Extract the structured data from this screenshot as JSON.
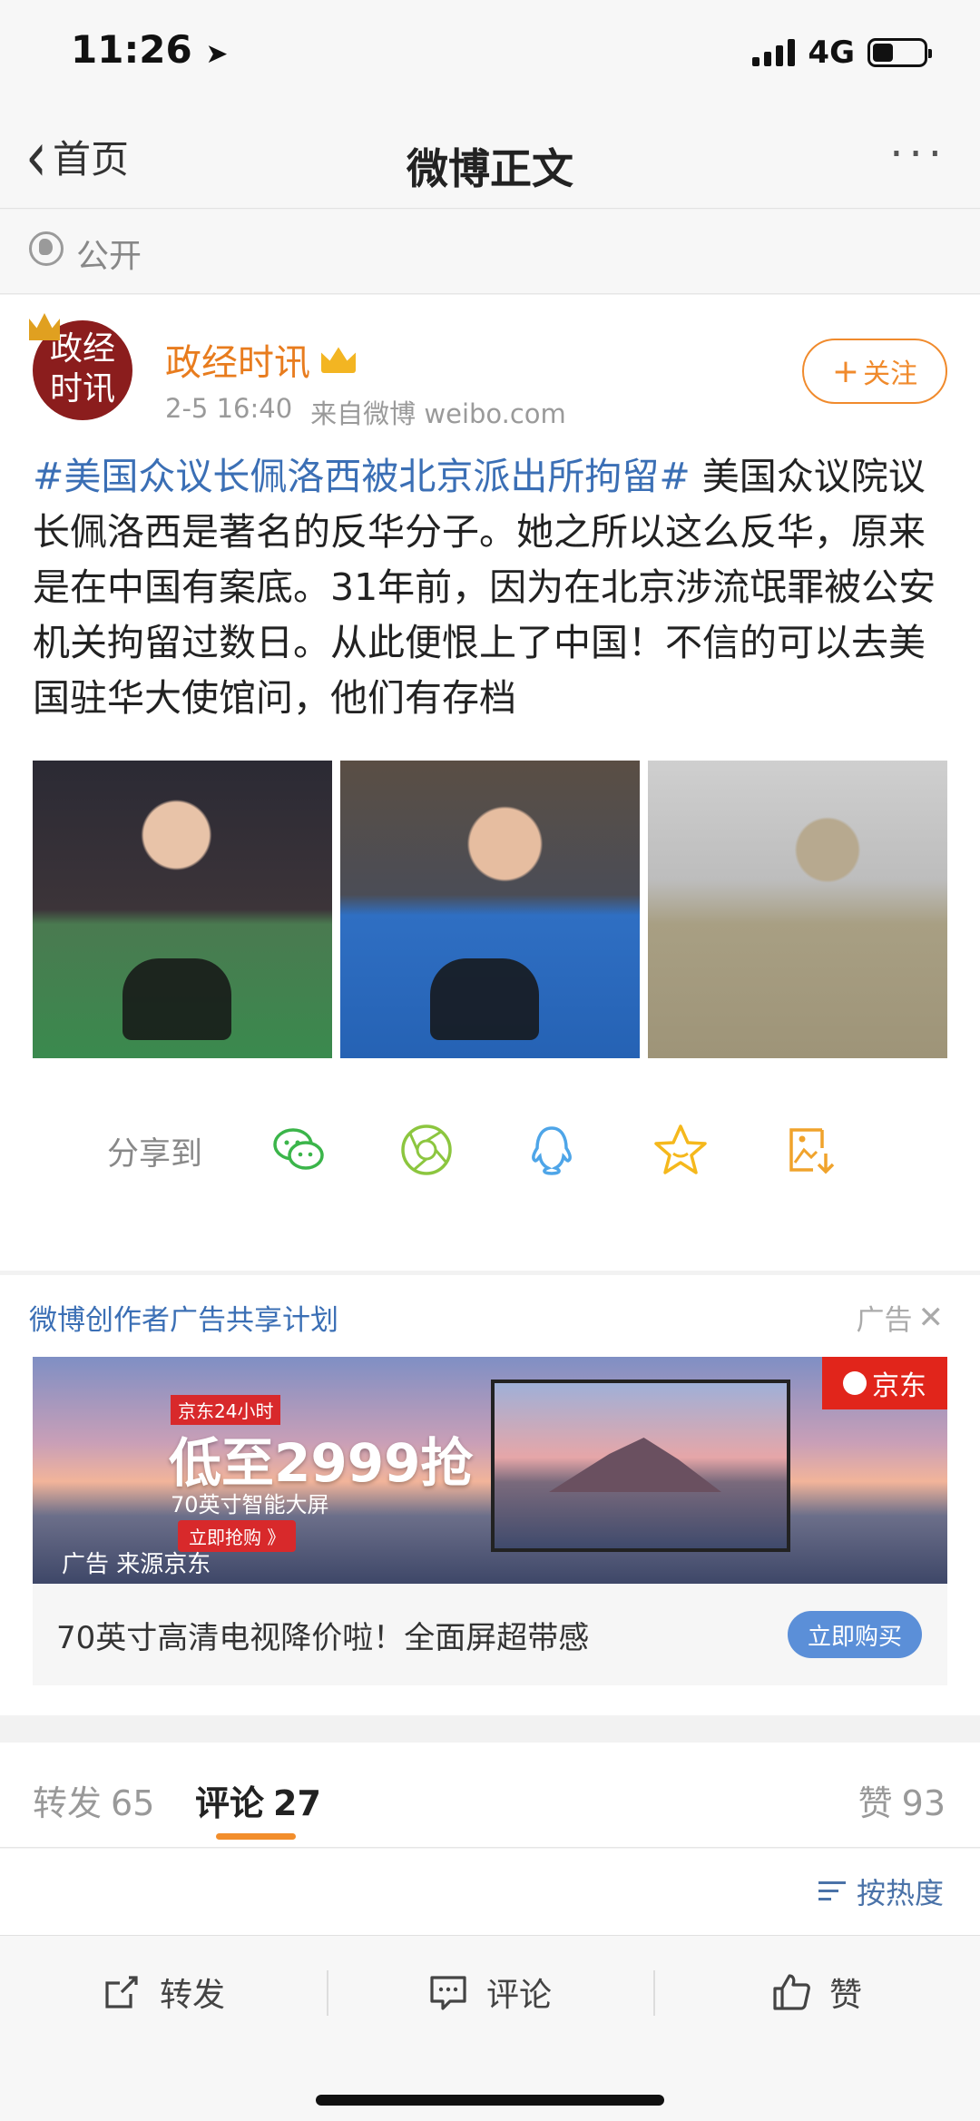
{
  "status_bar": {
    "time": "11:26",
    "network": "4G"
  },
  "nav": {
    "back_label": "首页",
    "title": "微博正文",
    "more": "···"
  },
  "visibility": {
    "label": "公开",
    "icon": "globe-icon"
  },
  "post": {
    "avatar_text_line1": "政经",
    "avatar_text_line2": "时讯",
    "author": "政经时讯",
    "time": "2-5 16:40",
    "source": "来自微博 weibo.com",
    "follow_label": "关注",
    "topic": "#美国众议长佩洛西被北京派出所拘留#",
    "body": " 美国众议院议长佩洛西是著名的反华分子。她之所以这么反华，原来是在中国有案底。31年前，因为在北京涉流氓罪被公安机关拘留过数日。从此便恨上了中国！不信的可以去美国驻华大使馆问，他们有存档",
    "share_label": "分享到"
  },
  "ad": {
    "program_title": "微博创作者广告共享计划",
    "ad_tag": "广告",
    "banner_promo": "京东24小时",
    "banner_headline": "低至2999抢",
    "banner_sub": "70英寸智能大屏",
    "banner_cta": "立即抢购 》",
    "banner_source": "广告 来源京东",
    "brand": "京东",
    "description": "70英寸高清电视降价啦！全面屏超带感",
    "buy_label": "立即购买"
  },
  "tabs": {
    "repost_label": "转发",
    "repost_count": "65",
    "comment_label": "评论",
    "comment_count": "27",
    "like_label": "赞",
    "like_count": "93"
  },
  "sort": {
    "label": "按热度"
  },
  "bottom_bar": {
    "repost": "转发",
    "comment": "评论",
    "like": "赞"
  },
  "colors": {
    "accent": "#f08a2c",
    "link": "#3b6fb5",
    "jd_red": "#e1251b"
  }
}
